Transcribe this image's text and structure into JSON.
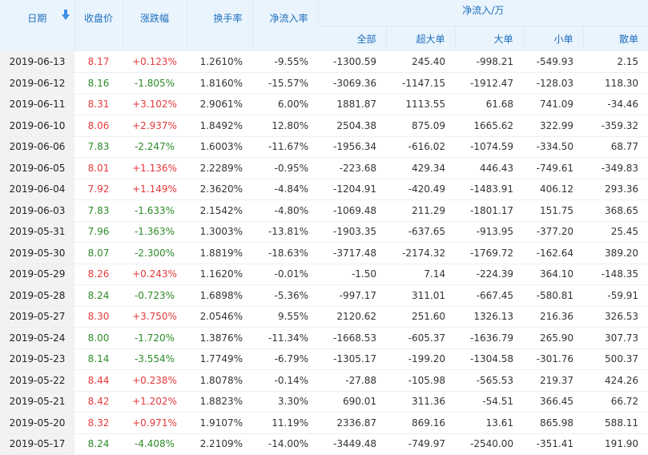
{
  "headers": {
    "date": "日期",
    "close": "收盘价",
    "change": "涨跌幅",
    "turnover": "换手率",
    "net_inflow_rate": "净流入率",
    "group": "净流入/万",
    "all": "全部",
    "super_large": "超大单",
    "large": "大单",
    "small": "小单",
    "retail": "散单"
  },
  "colors": {
    "up": "#e4393c",
    "down": "#2e8b29",
    "header_text": "#1e6fbd"
  },
  "rows": [
    {
      "date": "2019-06-13",
      "close": "8.17",
      "change": "+0.123%",
      "turnover": "1.2610%",
      "rate": "-9.55%",
      "all": "-1300.59",
      "super": "245.40",
      "large": "-998.21",
      "small": "-549.93",
      "retail": "2.15",
      "dir": "up"
    },
    {
      "date": "2019-06-12",
      "close": "8.16",
      "change": "-1.805%",
      "turnover": "1.8160%",
      "rate": "-15.57%",
      "all": "-3069.36",
      "super": "-1147.15",
      "large": "-1912.47",
      "small": "-128.03",
      "retail": "118.30",
      "dir": "down"
    },
    {
      "date": "2019-06-11",
      "close": "8.31",
      "change": "+3.102%",
      "turnover": "2.9061%",
      "rate": "6.00%",
      "all": "1881.87",
      "super": "1113.55",
      "large": "61.68",
      "small": "741.09",
      "retail": "-34.46",
      "dir": "up"
    },
    {
      "date": "2019-06-10",
      "close": "8.06",
      "change": "+2.937%",
      "turnover": "1.8492%",
      "rate": "12.80%",
      "all": "2504.38",
      "super": "875.09",
      "large": "1665.62",
      "small": "322.99",
      "retail": "-359.32",
      "dir": "up"
    },
    {
      "date": "2019-06-06",
      "close": "7.83",
      "change": "-2.247%",
      "turnover": "1.6003%",
      "rate": "-11.67%",
      "all": "-1956.34",
      "super": "-616.02",
      "large": "-1074.59",
      "small": "-334.50",
      "retail": "68.77",
      "dir": "down"
    },
    {
      "date": "2019-06-05",
      "close": "8.01",
      "change": "+1.136%",
      "turnover": "2.2289%",
      "rate": "-0.95%",
      "all": "-223.68",
      "super": "429.34",
      "large": "446.43",
      "small": "-749.61",
      "retail": "-349.83",
      "dir": "up"
    },
    {
      "date": "2019-06-04",
      "close": "7.92",
      "change": "+1.149%",
      "turnover": "2.3620%",
      "rate": "-4.84%",
      "all": "-1204.91",
      "super": "-420.49",
      "large": "-1483.91",
      "small": "406.12",
      "retail": "293.36",
      "dir": "up"
    },
    {
      "date": "2019-06-03",
      "close": "7.83",
      "change": "-1.633%",
      "turnover": "2.1542%",
      "rate": "-4.80%",
      "all": "-1069.48",
      "super": "211.29",
      "large": "-1801.17",
      "small": "151.75",
      "retail": "368.65",
      "dir": "down"
    },
    {
      "date": "2019-05-31",
      "close": "7.96",
      "change": "-1.363%",
      "turnover": "1.3003%",
      "rate": "-13.81%",
      "all": "-1903.35",
      "super": "-637.65",
      "large": "-913.95",
      "small": "-377.20",
      "retail": "25.45",
      "dir": "down"
    },
    {
      "date": "2019-05-30",
      "close": "8.07",
      "change": "-2.300%",
      "turnover": "1.8819%",
      "rate": "-18.63%",
      "all": "-3717.48",
      "super": "-2174.32",
      "large": "-1769.72",
      "small": "-162.64",
      "retail": "389.20",
      "dir": "down"
    },
    {
      "date": "2019-05-29",
      "close": "8.26",
      "change": "+0.243%",
      "turnover": "1.1620%",
      "rate": "-0.01%",
      "all": "-1.50",
      "super": "7.14",
      "large": "-224.39",
      "small": "364.10",
      "retail": "-148.35",
      "dir": "up"
    },
    {
      "date": "2019-05-28",
      "close": "8.24",
      "change": "-0.723%",
      "turnover": "1.6898%",
      "rate": "-5.36%",
      "all": "-997.17",
      "super": "311.01",
      "large": "-667.45",
      "small": "-580.81",
      "retail": "-59.91",
      "dir": "down"
    },
    {
      "date": "2019-05-27",
      "close": "8.30",
      "change": "+3.750%",
      "turnover": "2.0546%",
      "rate": "9.55%",
      "all": "2120.62",
      "super": "251.60",
      "large": "1326.13",
      "small": "216.36",
      "retail": "326.53",
      "dir": "up"
    },
    {
      "date": "2019-05-24",
      "close": "8.00",
      "change": "-1.720%",
      "turnover": "1.3876%",
      "rate": "-11.34%",
      "all": "-1668.53",
      "super": "-605.37",
      "large": "-1636.79",
      "small": "265.90",
      "retail": "307.73",
      "dir": "down"
    },
    {
      "date": "2019-05-23",
      "close": "8.14",
      "change": "-3.554%",
      "turnover": "1.7749%",
      "rate": "-6.79%",
      "all": "-1305.17",
      "super": "-199.20",
      "large": "-1304.58",
      "small": "-301.76",
      "retail": "500.37",
      "dir": "down"
    },
    {
      "date": "2019-05-22",
      "close": "8.44",
      "change": "+0.238%",
      "turnover": "1.8078%",
      "rate": "-0.14%",
      "all": "-27.88",
      "super": "-105.98",
      "large": "-565.53",
      "small": "219.37",
      "retail": "424.26",
      "dir": "up"
    },
    {
      "date": "2019-05-21",
      "close": "8.42",
      "change": "+1.202%",
      "turnover": "1.8823%",
      "rate": "3.30%",
      "all": "690.01",
      "super": "311.36",
      "large": "-54.51",
      "small": "366.45",
      "retail": "66.72",
      "dir": "up"
    },
    {
      "date": "2019-05-20",
      "close": "8.32",
      "change": "+0.971%",
      "turnover": "1.9107%",
      "rate": "11.19%",
      "all": "2336.87",
      "super": "869.16",
      "large": "13.61",
      "small": "865.98",
      "retail": "588.11",
      "dir": "up"
    },
    {
      "date": "2019-05-17",
      "close": "8.24",
      "change": "-4.408%",
      "turnover": "2.2109%",
      "rate": "-14.00%",
      "all": "-3449.48",
      "super": "-749.97",
      "large": "-2540.00",
      "small": "-351.41",
      "retail": "191.90",
      "dir": "down"
    }
  ]
}
